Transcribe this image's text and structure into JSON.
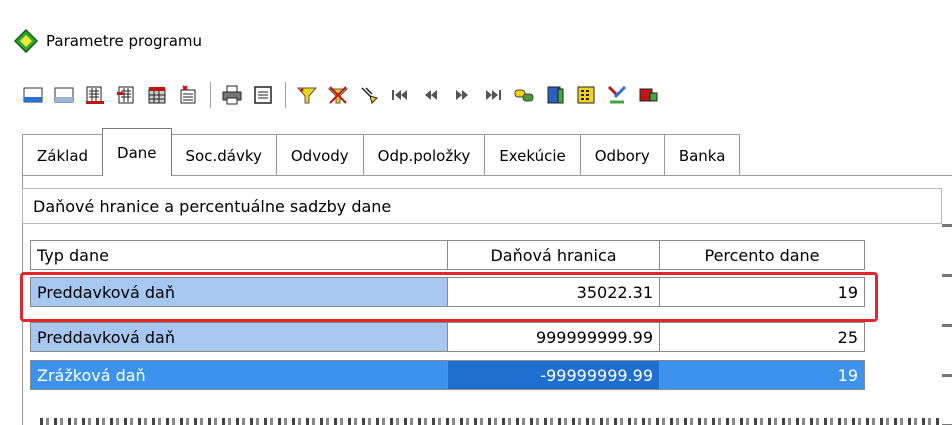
{
  "window": {
    "title": "Parametre programu",
    "icon": "green-diamond-icon"
  },
  "toolbar": {
    "buttons": [
      "first-record-icon",
      "last-record-icon",
      "calc-sheet-icon",
      "calc-sheet-2-icon",
      "calendar-grid-icon",
      "list-delete-icon",
      "print-icon",
      "preview-icon",
      "filter-icon",
      "clear-filter-icon",
      "pointer-icon",
      "nav-first-icon",
      "nav-prev-icon",
      "nav-next-icon",
      "nav-last-icon",
      "chain-icon",
      "book-icon",
      "calc-yellow-icon",
      "tools-icon",
      "red-box-icon"
    ]
  },
  "tabs": [
    {
      "label": "Základ",
      "active": false
    },
    {
      "label": "Dane",
      "active": true
    },
    {
      "label": "Soc.dávky",
      "active": false
    },
    {
      "label": "Odvody",
      "active": false
    },
    {
      "label": "Odp.položky",
      "active": false
    },
    {
      "label": "Exekúcie",
      "active": false
    },
    {
      "label": "Odbory",
      "active": false
    },
    {
      "label": "Banka",
      "active": false
    }
  ],
  "group": {
    "title": "Daňové hranice a percentuálne sadzby dane"
  },
  "table": {
    "headers": [
      "Typ dane",
      "Daňová hranica",
      "Percento dane"
    ],
    "rows": [
      [
        "Preddavková daň",
        "35022.31",
        "19"
      ],
      [
        "Preddavková daň",
        "999999999.99",
        "25"
      ],
      [
        "Zrážková daň",
        "-99999999.99",
        "19"
      ]
    ]
  },
  "colors": {
    "highlight": "#e3262c",
    "row_light": "#a6c8f0",
    "row_selected": "#3c93ee"
  }
}
